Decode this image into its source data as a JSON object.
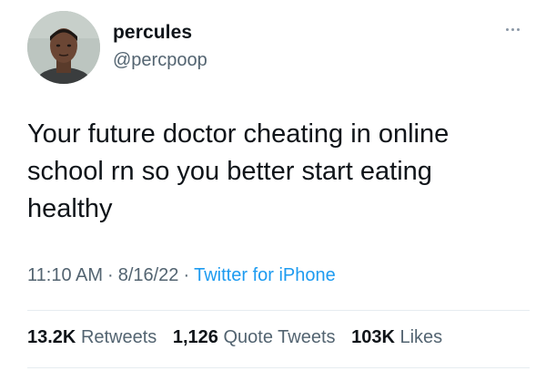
{
  "author": {
    "display_name": "percules",
    "handle": "@percpoop"
  },
  "tweet": {
    "text": "Your future doctor cheating in online\nschool rn so you better start eating\nhealthy"
  },
  "meta": {
    "time": "11:10 AM",
    "date": "8/16/22",
    "separator": "·",
    "source": "Twitter for iPhone"
  },
  "stats": {
    "retweets_count": "13.2K",
    "retweets_label": "Retweets",
    "quotes_count": "1,126",
    "quotes_label": "Quote Tweets",
    "likes_count": "103K",
    "likes_label": "Likes"
  },
  "icons": {
    "more": "more-horizontal-icon"
  },
  "colors": {
    "text": "#0f1419",
    "secondary": "#536471",
    "link": "#1d9bf0",
    "divider": "#e6ecf0"
  }
}
